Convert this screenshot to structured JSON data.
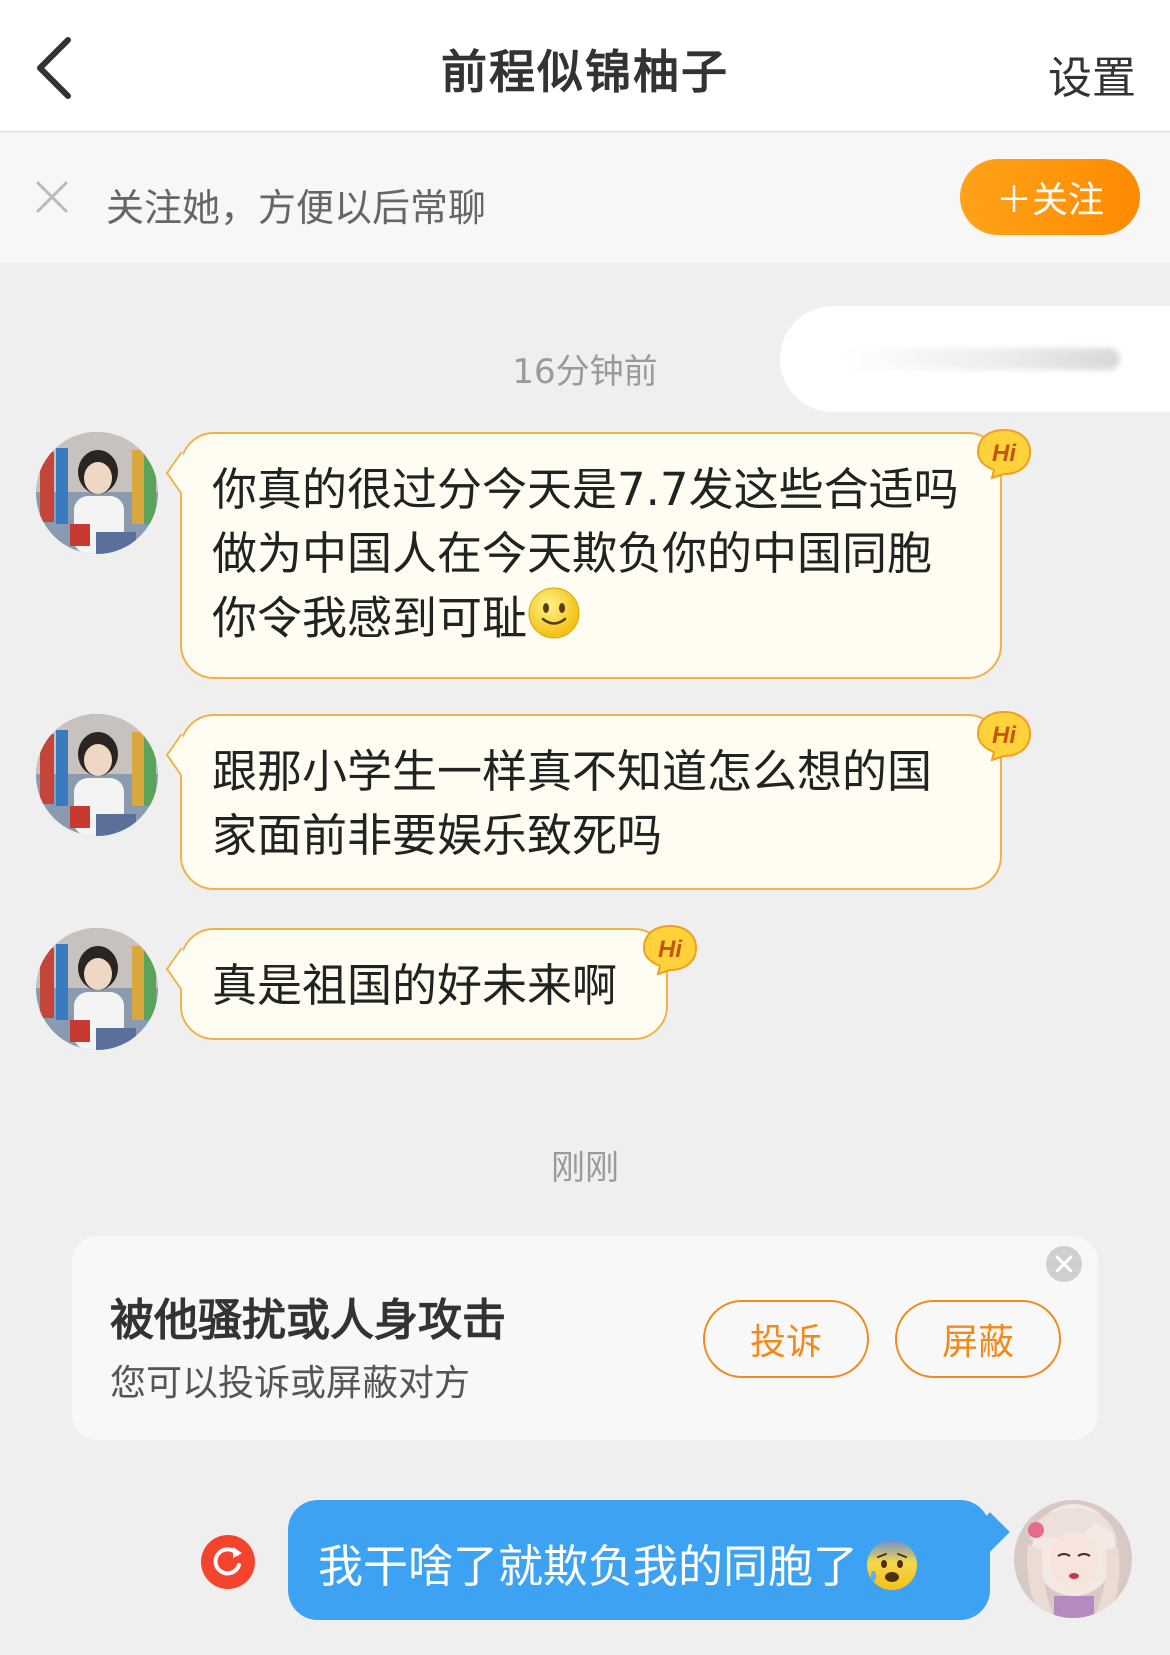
{
  "header": {
    "title": "前程似锦柚子",
    "settings_label": "设置",
    "back_icon": "chevron-left-icon"
  },
  "follow_bar": {
    "text": "关注她，方便以后常聊",
    "button_label": "＋关注",
    "close_icon": "close-icon"
  },
  "messages": {
    "time_1": "16分钟前",
    "incoming": [
      {
        "text": "你真的很过分今天是7.7发这些合适吗做为中国人在今天欺负你的中国同胞你令我感到可耻",
        "badge": "Hi",
        "emoji": "smile-emoji"
      },
      {
        "text": "跟那小学生一样真不知道怎么想的国家面前非要娱乐致死吗",
        "badge": "Hi"
      },
      {
        "text": "真是祖国的好未来啊",
        "badge": "Hi"
      }
    ],
    "time_2": "刚刚",
    "outgoing": {
      "text": "我干啥了就欺负我的同胞了",
      "emoji": "anxious-sweat-emoji",
      "status_icon": "resend-icon"
    }
  },
  "report_card": {
    "title": "被他骚扰或人身攻击",
    "subtitle": "您可以投诉或屏蔽对方",
    "complain_label": "投诉",
    "block_label": "屏蔽",
    "close_icon": "close-circle-icon"
  },
  "colors": {
    "accent_orange": "#ff9500",
    "bubble_border": "#f0b24a",
    "outgoing_blue": "#3ea2f2",
    "resend_red": "#f4442e"
  }
}
